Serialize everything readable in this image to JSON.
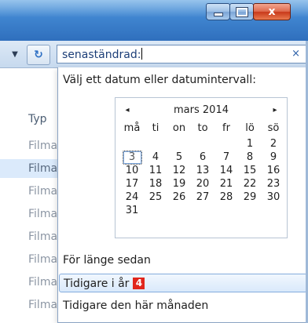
{
  "window": {
    "caption_buttons": {
      "minimize_icon": "minimize-icon",
      "maximize_icon": "maximize-icon",
      "close_label": "x"
    }
  },
  "toolbar": {
    "refresh_glyph": "↻",
    "search": {
      "value": "senaständrad:",
      "clear": "×"
    }
  },
  "list": {
    "column_header": "Typ",
    "rows": [
      "Filma",
      "Filma",
      "Filma",
      "Filma",
      "Filma",
      "Filma",
      "Filma",
      "Filma"
    ],
    "selected_index": 1
  },
  "dropdown": {
    "prompt": "Välj ett datum eller datumintervall:",
    "calendar": {
      "title": "mars 2014",
      "prev": "◂",
      "next": "▸",
      "weekdays": [
        "må",
        "ti",
        "on",
        "to",
        "fr",
        "lö",
        "sö"
      ],
      "weeks": [
        [
          "",
          "",
          "",
          "",
          "",
          "1",
          "2"
        ],
        [
          "3",
          "4",
          "5",
          "6",
          "7",
          "8",
          "9"
        ],
        [
          "10",
          "11",
          "12",
          "13",
          "14",
          "15",
          "16"
        ],
        [
          "17",
          "18",
          "19",
          "20",
          "21",
          "22",
          "23"
        ],
        [
          "24",
          "25",
          "26",
          "27",
          "28",
          "29",
          "30"
        ],
        [
          "31",
          "",
          "",
          "",
          "",
          "",
          ""
        ]
      ],
      "today": "3"
    },
    "options": [
      {
        "label": "För länge sedan",
        "badge": ""
      },
      {
        "label": "Tidigare i år",
        "badge": "4"
      },
      {
        "label": "Tidigare den här månaden",
        "badge": ""
      }
    ],
    "hover_index": 1
  }
}
